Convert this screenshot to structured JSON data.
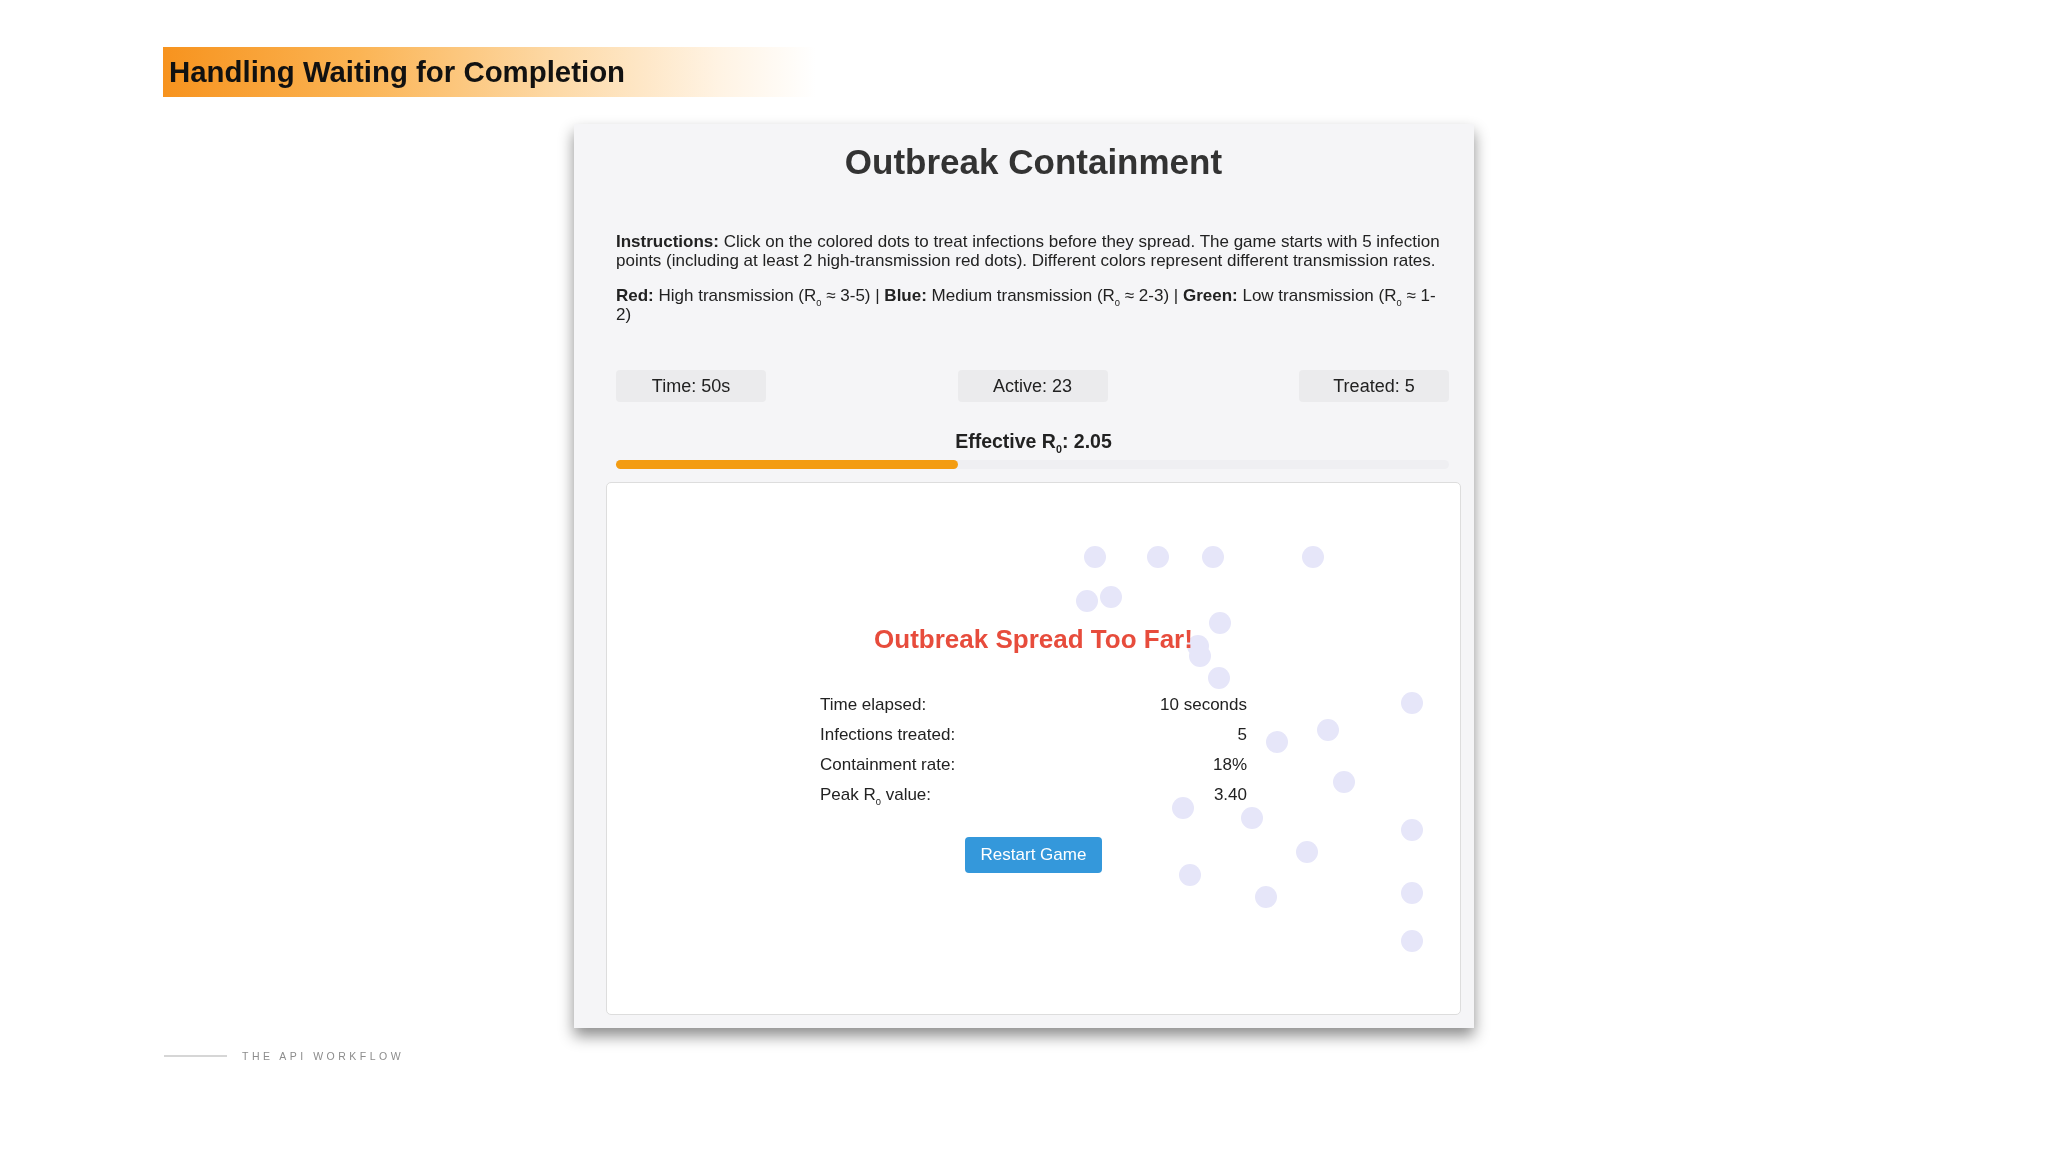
{
  "slide": {
    "title": "Handling Waiting for Completion"
  },
  "game": {
    "title": "Outbreak Containment",
    "instructions": "**Instructions:** Click on the colored dots to treat infections before they spread. The game starts with 5 infection points (including at least 2 high-transmission red dots). Different colors represent different transmission rates.",
    "legend": "**Red:** High transmission (R$_{0}$ ≈ 3-5) | **Blue:** Medium transmission (R$_{0}$ ≈ 2-3) | **Green:** Low transmission (R$_{0}$ ≈ 1-2)",
    "stats": [
      "Time: 50s",
      "Active: 23",
      "Treated: 5"
    ],
    "effective_r": {
      "label": "Effective R$_{0}$: 2.05",
      "level": 0.41
    },
    "result": {
      "title": "Outbreak Spread Too Far!",
      "rows": [
        {
          "label": "Time elapsed:",
          "value": "10 seconds"
        },
        {
          "label": "Infections treated:",
          "value": "5"
        },
        {
          "label": "Containment rate:",
          "value": "18%"
        },
        {
          "label": "Peak R$_{0}$ value:",
          "value": "3.40"
        }
      ],
      "button": "Restart Game"
    }
  },
  "footer": {
    "text": "THE API WORKFLOW"
  }
}
